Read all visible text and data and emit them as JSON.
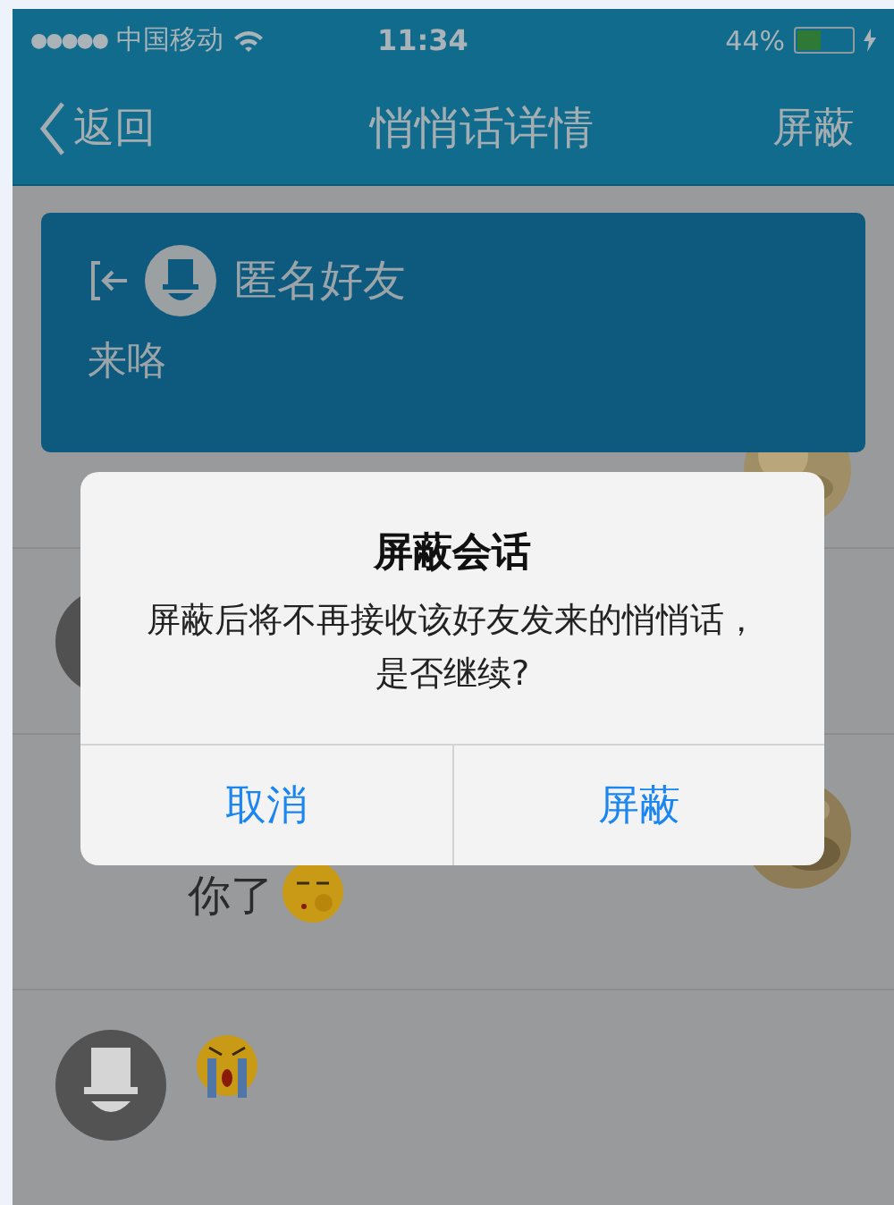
{
  "status_bar": {
    "signal": "●●●●●",
    "carrier": "中国移动",
    "time": "11:34",
    "battery_text": "44%",
    "battery": {
      "level": 0.44
    }
  },
  "nav_bar": {
    "back": "返回",
    "title": "悄悄话详情",
    "action": "屏蔽"
  },
  "pinned_message": {
    "sender": "匿名好友",
    "text": "来咯"
  },
  "feed": [
    {
      "text": "你了"
    }
  ],
  "dialog": {
    "title": "屏蔽会话",
    "message": "屏蔽后将不再接收该好友发来的悄悄话，是否继续?",
    "buttons": [
      "取消",
      "屏蔽"
    ]
  }
}
